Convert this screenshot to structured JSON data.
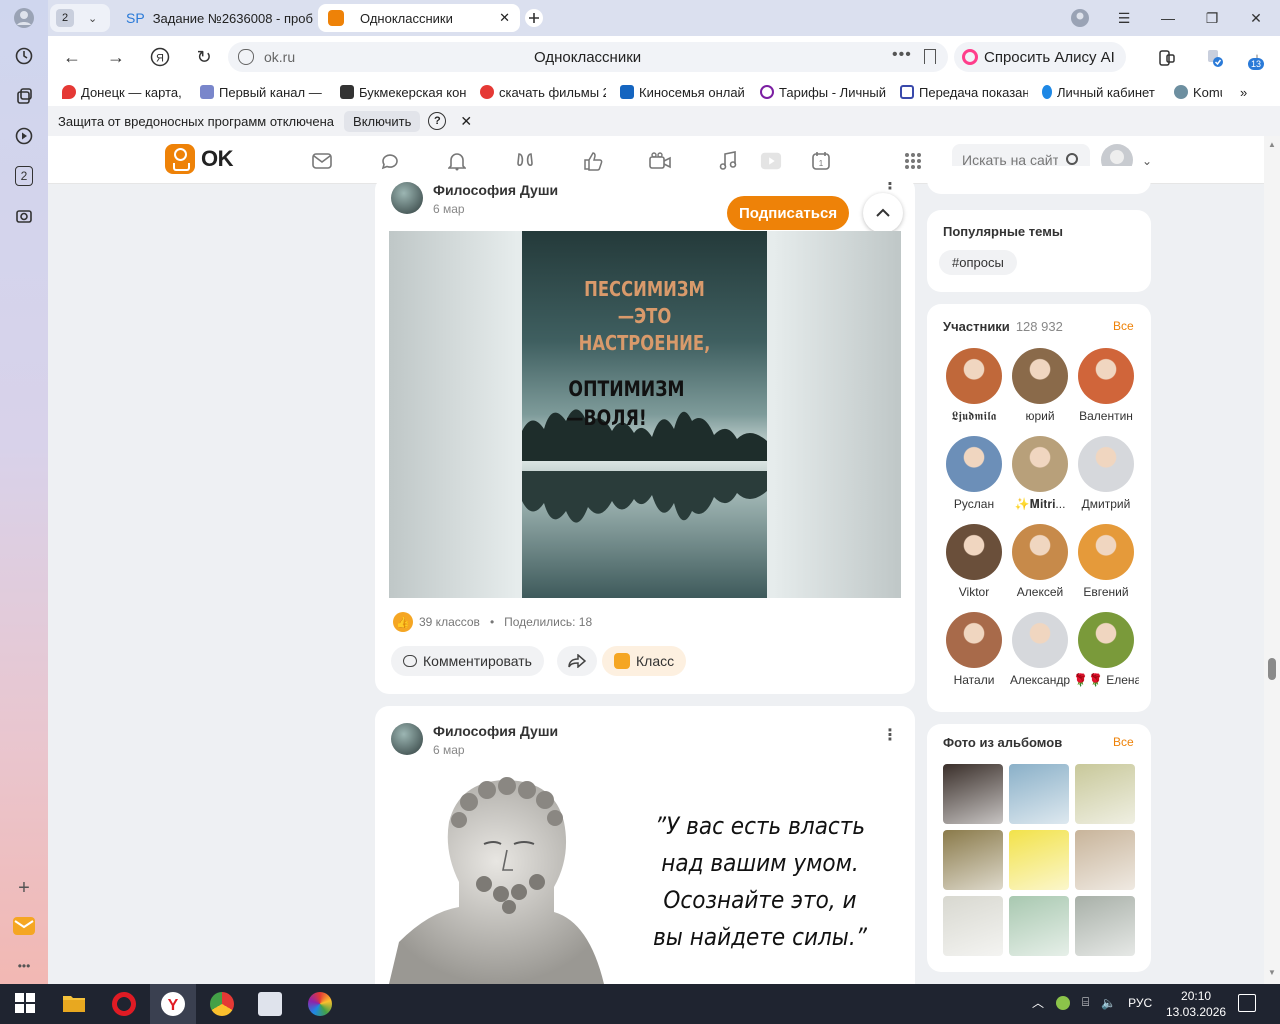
{
  "browser": {
    "tab_count": "2",
    "tabs": [
      {
        "label": "Задание №2636008 - проб",
        "favicon": "SP"
      },
      {
        "label": "Одноклассники"
      }
    ],
    "url": "ok.ru",
    "page_title": "Одноклассники",
    "alice_label": "Спросить Алису AI",
    "downloads_badge": "13",
    "bookmarks": [
      {
        "label": "Донецк — карта, ",
        "color": "#e53935"
      },
      {
        "label": "Первый канал — ",
        "color": "#5c6bc0"
      },
      {
        "label": "Букмекерская кон",
        "color": "#333333"
      },
      {
        "label": "скачать фильмы 2",
        "color": "#e53935"
      },
      {
        "label": "Киносемья онлай",
        "color": "#1565c0"
      },
      {
        "label": "Тарифы - Личный",
        "color": "#7b1fa2"
      },
      {
        "label": "Передача показан",
        "color": "#3949ab"
      },
      {
        "label": "Личный кабинет",
        "color": "#1e88e5"
      },
      {
        "label": "Komus",
        "color": "#6d8fa0"
      }
    ],
    "notice": {
      "text": "Защита от вредоносных программ отключена",
      "enable_label": "Включить",
      "help": "?",
      "close": "✕"
    },
    "rail_badge": "2"
  },
  "ok": {
    "logo_text": "OK",
    "search_placeholder": "Искать на сайте"
  },
  "posts": [
    {
      "author": "Философия Души",
      "date": "6 мар",
      "image_text": [
        "ПЕССИМИЗМ",
        "—ЭТО",
        "НАСТРОЕНИЕ,",
        "ОПТИМИЗМ",
        "—ВОЛЯ!"
      ],
      "likes": "39 классов",
      "shares": "Поделились: 18",
      "comment_label": "Комментировать",
      "klass_label": "Класс",
      "subscribe_label": "Подписаться"
    },
    {
      "author": "Философия Души",
      "date": "6 мар",
      "quote_lines": [
        "”У вас есть власть",
        "над вашим умом.",
        "Осознайте это, и",
        "вы найдете силы.”"
      ]
    }
  ],
  "sidebar": {
    "popular_title": "Популярные темы",
    "tag": "#опросы",
    "members_title": "Участники",
    "members_count": "128 932",
    "all_label": "Все",
    "members": [
      {
        "name": "𝕷𝖏𝖚𝖉𝖒𝖎𝖑𝖆",
        "color": "#c0683a"
      },
      {
        "name": "юрий",
        "color": "#8a6a4a"
      },
      {
        "name": "Валентин",
        "color": "#d0653a"
      },
      {
        "name": "Руслан",
        "color": "#6c8fb8"
      },
      {
        "name": "✨𝐌𝐢𝐭𝐫𝐢...",
        "color": "#b8a07a"
      },
      {
        "name": "Дмитрий",
        "color": "#d6d8dc"
      },
      {
        "name": "Viktor",
        "color": "#6a4f3a"
      },
      {
        "name": "Алексей",
        "color": "#c78a4a"
      },
      {
        "name": "Евгений",
        "color": "#e59a3a"
      },
      {
        "name": "Натали",
        "color": "#a86a4a"
      },
      {
        "name": "Александр",
        "color": "#d6d8dc"
      },
      {
        "name": "🌹🌹 Елена",
        "color": "#7a9a3a"
      }
    ],
    "photos_title": "Фото из альбомов",
    "photos_all": "Все",
    "photos": [
      {
        "color": "#3a2f2a"
      },
      {
        "color": "#8ab0c8"
      },
      {
        "color": "#c8c89a"
      },
      {
        "color": "#8a7a4a"
      },
      {
        "color": "#f2e24a"
      },
      {
        "color": "#c8b49a"
      },
      {
        "color": "#d8d8d0"
      },
      {
        "color": "#a8c8b0"
      },
      {
        "color": "#a8b0a8"
      }
    ]
  },
  "taskbar": {
    "lang": "РУС",
    "time": "20:10",
    "date": "13.03.2026"
  }
}
